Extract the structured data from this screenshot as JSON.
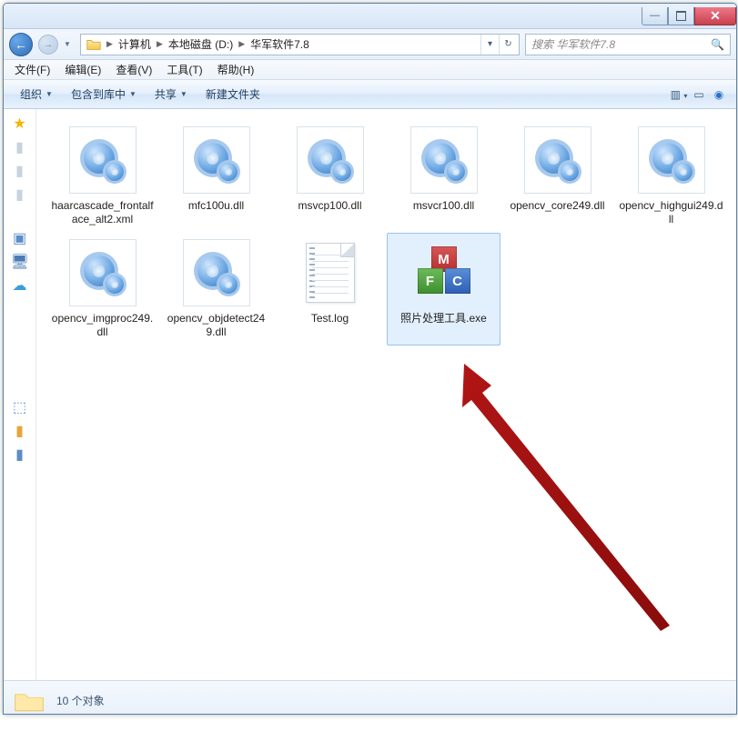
{
  "breadcrumb": {
    "p1": "计算机",
    "p2": "本地磁盘 (D:)",
    "p3": "华军软件7.8"
  },
  "search": {
    "placeholder": "搜索 华军软件7.8"
  },
  "menu": {
    "file": "文件(F)",
    "edit": "编辑(E)",
    "view": "查看(V)",
    "tools": "工具(T)",
    "help": "帮助(H)"
  },
  "toolbar": {
    "organize": "组织",
    "include": "包含到库中",
    "share": "共享",
    "newfolder": "新建文件夹"
  },
  "files": [
    {
      "name": "haarcascade_frontalface_alt2.xml",
      "type": "gear"
    },
    {
      "name": "mfc100u.dll",
      "type": "gear"
    },
    {
      "name": "msvcp100.dll",
      "type": "gear"
    },
    {
      "name": "msvcr100.dll",
      "type": "gear"
    },
    {
      "name": "opencv_core249.dll",
      "type": "gear"
    },
    {
      "name": "opencv_highgui249.dll",
      "type": "gear"
    },
    {
      "name": "opencv_imgproc249.dll",
      "type": "gear"
    },
    {
      "name": "opencv_objdetect249.dll",
      "type": "gear"
    },
    {
      "name": "Test.log",
      "type": "text"
    },
    {
      "name": "照片处理工具.exe",
      "type": "exe",
      "selected": true
    }
  ],
  "status": {
    "count": "10 个对象"
  },
  "bgtabs": {
    "t1": "",
    "t2": ""
  }
}
